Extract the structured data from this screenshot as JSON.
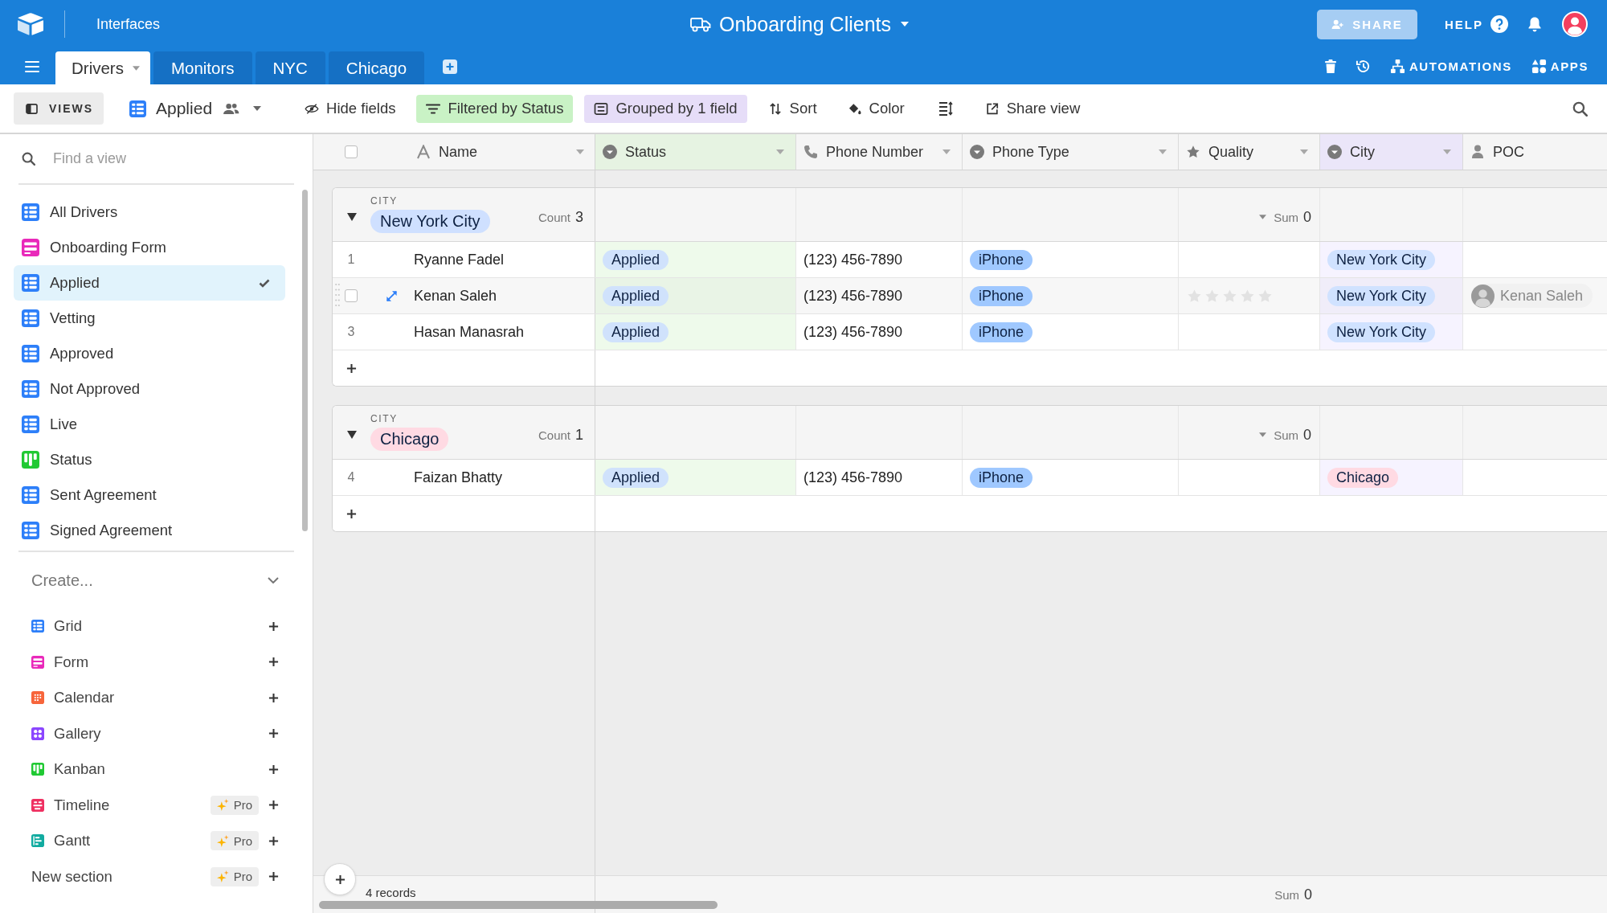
{
  "app_bar": {
    "workspace": "Interfaces",
    "base_title": "Onboarding Clients",
    "share_label": "SHARE",
    "help_label": "HELP"
  },
  "tabs": [
    {
      "label": "Drivers",
      "selected": true
    },
    {
      "label": "Monitors",
      "selected": false
    },
    {
      "label": "NYC",
      "selected": false
    },
    {
      "label": "Chicago",
      "selected": false
    }
  ],
  "tab_actions": [
    {
      "kind": "trash"
    },
    {
      "kind": "history"
    },
    {
      "kind": "automations",
      "label": "AUTOMATIONS"
    },
    {
      "kind": "apps",
      "label": "APPS"
    }
  ],
  "view_bar": {
    "views_label": "VIEWS",
    "view_name": "Applied",
    "tools": [
      {
        "kind": "hide",
        "label": "Hide fields"
      },
      {
        "kind": "filter",
        "label": "Filtered by Status",
        "color": "#c9f2c5"
      },
      {
        "kind": "group",
        "label": "Grouped by 1 field",
        "color": "#e6ddf8"
      },
      {
        "kind": "sort",
        "label": "Sort"
      },
      {
        "kind": "color",
        "label": "Color"
      },
      {
        "kind": "row_height"
      },
      {
        "kind": "share",
        "label": "Share view"
      }
    ]
  },
  "sidebar": {
    "search": {
      "placeholder": "Find a view"
    },
    "views": [
      {
        "kind": "grid",
        "label": "All Drivers",
        "selected": false
      },
      {
        "kind": "form",
        "label": "Onboarding Form",
        "selected": false
      },
      {
        "kind": "grid",
        "label": "Applied",
        "selected": true
      },
      {
        "kind": "grid",
        "label": "Vetting",
        "selected": false
      },
      {
        "kind": "grid",
        "label": "Approved",
        "selected": false
      },
      {
        "kind": "grid",
        "label": "Not Approved",
        "selected": false
      },
      {
        "kind": "grid",
        "label": "Live",
        "selected": false
      },
      {
        "kind": "kanban",
        "label": "Status",
        "selected": false
      },
      {
        "kind": "grid",
        "label": "Sent Agreement",
        "selected": false
      },
      {
        "kind": "grid",
        "label": "Signed Agreement",
        "selected": false
      }
    ],
    "create": {
      "label": "Create...",
      "expanded": true,
      "items": [
        {
          "kind": "grid",
          "label": "Grid"
        },
        {
          "kind": "form",
          "label": "Form"
        },
        {
          "kind": "calendar",
          "label": "Calendar"
        },
        {
          "kind": "gallery",
          "label": "Gallery"
        },
        {
          "kind": "kanban",
          "label": "Kanban"
        },
        {
          "kind": "timeline",
          "label": "Timeline",
          "badge": "Pro"
        },
        {
          "kind": "gantt",
          "label": "Gantt",
          "badge": "Pro"
        },
        {
          "kind": "section",
          "label": "New section",
          "badge": "Pro"
        }
      ]
    }
  },
  "grid": {
    "select_all": {
      "checked": false
    },
    "columns": [
      {
        "kind": "text",
        "label": "Name",
        "filtered": false,
        "grouped": false,
        "menu": true
      },
      {
        "kind": "select",
        "label": "Status",
        "filtered": true,
        "grouped": false,
        "menu": true
      },
      {
        "kind": "phone",
        "label": "Phone Number",
        "filtered": false,
        "grouped": false,
        "menu": true
      },
      {
        "kind": "select",
        "label": "Phone Type",
        "filtered": false,
        "grouped": false,
        "menu": true
      },
      {
        "kind": "rating",
        "label": "Quality",
        "filtered": false,
        "grouped": false,
        "menu": true
      },
      {
        "kind": "select",
        "label": "City",
        "filtered": false,
        "grouped": true,
        "menu": true
      },
      {
        "kind": "user",
        "label": "POC",
        "filtered": false,
        "grouped": false,
        "menu": false
      }
    ],
    "groups": [
      {
        "field": "CITY",
        "value": {
          "label": "New York City",
          "color": "#cfe0ff"
        },
        "expanded": true,
        "count_label": "Count",
        "count": "3",
        "sum_label": "Sum",
        "sum": "0",
        "rows": [
          {
            "number": "1",
            "hovered": false,
            "checked": false,
            "name": "Ryanne Fadel",
            "status": {
              "label": "Applied",
              "color": "#d0e2fc"
            },
            "phone_number": "(123) 456-7890",
            "phone_type": {
              "label": "iPhone",
              "color": "#9fc8ff"
            },
            "city": {
              "label": "New York City",
              "color": "#d0e2ff"
            }
          },
          {
            "hovered": true,
            "checked": false,
            "name": "Kenan Saleh",
            "status": {
              "label": "Applied",
              "color": "#d0e2fc"
            },
            "phone_number": "(123) 456-7890",
            "phone_type": {
              "label": "iPhone",
              "color": "#9fc8ff"
            },
            "quality": {
              "stars": 0
            },
            "city": {
              "label": "New York City",
              "color": "#d0e2ff"
            },
            "poc": "Kenan Saleh"
          },
          {
            "number": "3",
            "hovered": false,
            "checked": false,
            "name": "Hasan Manasrah",
            "status": {
              "label": "Applied",
              "color": "#d0e2fc"
            },
            "phone_number": "(123) 456-7890",
            "phone_type": {
              "label": "iPhone",
              "color": "#9fc8ff"
            },
            "city": {
              "label": "New York City",
              "color": "#d0e2ff"
            }
          }
        ]
      },
      {
        "field": "CITY",
        "value": {
          "label": "Chicago",
          "color": "#ffdae3"
        },
        "expanded": true,
        "count_label": "Count",
        "count": "1",
        "sum_label": "Sum",
        "sum": "0",
        "rows": [
          {
            "number": "4",
            "hovered": false,
            "checked": false,
            "name": "Faizan Bhatty",
            "status": {
              "label": "Applied",
              "color": "#d0e2fc"
            },
            "phone_number": "(123) 456-7890",
            "phone_type": {
              "label": "iPhone",
              "color": "#9fc8ff"
            },
            "city": {
              "label": "Chicago",
              "color": "#ffdae3"
            }
          }
        ]
      }
    ],
    "footer": {
      "records": "4 records",
      "sum_label": "Sum",
      "sum": "0"
    }
  }
}
